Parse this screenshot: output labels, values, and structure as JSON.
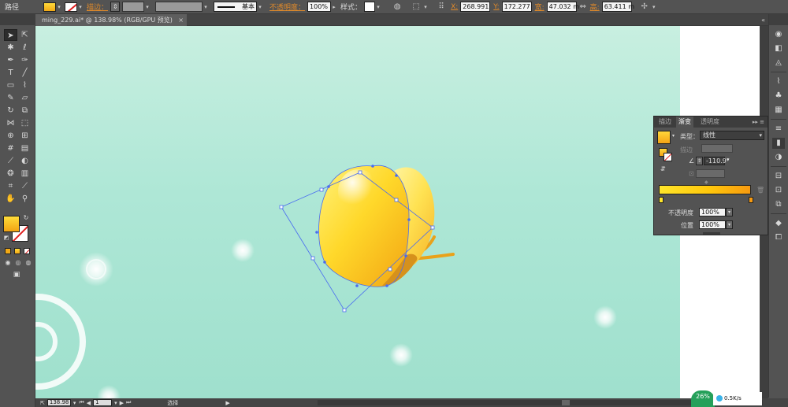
{
  "control_bar": {
    "object_type": "路径",
    "stroke_label": "描边：",
    "stroke_profile": "基本",
    "opacity_label": "不透明度：",
    "opacity_value": "100%",
    "style_label": "样式：",
    "x_label": "X:",
    "x_value": "268.991",
    "y_label": "Y:",
    "y_value": "172.277",
    "w_label": "宽:",
    "w_value": "47.032 m",
    "h_label": "高:",
    "h_value": "63.411 m"
  },
  "document_tab": {
    "title": "ming_229.ai* @ 138.98% (RGB/GPU 预览)",
    "close": "×"
  },
  "status_bar": {
    "zoom": "138.98",
    "page": "1",
    "mode": "选择"
  },
  "network_widget": {
    "percent": "26%",
    "speed": "0.5K/s"
  },
  "gradient_panel": {
    "tabs": [
      "描边",
      "渐变",
      "透明度"
    ],
    "active_tab": "渐变",
    "type_label": "类型：",
    "type_value": "线性",
    "stroke_label": "描边",
    "angle_value": "-110.9°",
    "opacity_label": "不透明度",
    "opacity_value": "100%",
    "location_label": "位置",
    "location_value": "100%",
    "gradient_start_color": "#ffe52a",
    "gradient_end_color": "#f79a10"
  },
  "colors": {
    "ui_bg": "#535353",
    "artboard_top": "#c8efe0",
    "artboard_bottom": "#9fe0cd",
    "accent_orange": "#e08a2a",
    "selection_blue": "#4a6cf0"
  },
  "icons": {
    "tools": [
      "selection-tool",
      "direct-selection-tool",
      "magic-wand-tool",
      "lasso-tool",
      "pen-tool",
      "curvature-tool",
      "type-tool",
      "line-tool",
      "rectangle-tool",
      "paintbrush-tool",
      "pencil-tool",
      "eraser-tool",
      "rotate-tool",
      "scale-tool",
      "width-tool",
      "free-transform-tool",
      "shape-builder-tool",
      "perspective-grid-tool",
      "mesh-tool",
      "gradient-tool",
      "eyedropper-tool",
      "blend-tool",
      "symbol-sprayer-tool",
      "column-graph-tool",
      "artboard-tool",
      "slice-tool",
      "hand-tool",
      "zoom-tool"
    ],
    "right_dock": [
      "appearance-icon",
      "graphic-styles-icon",
      "color-guide-icon",
      "brushes-icon",
      "symbols-icon",
      "swatches-icon",
      "stroke-icon",
      "gradient-icon",
      "transparency-icon",
      "align-icon",
      "transform-icon",
      "pathfinder-icon",
      "layers-icon",
      "artboards-icon"
    ]
  }
}
